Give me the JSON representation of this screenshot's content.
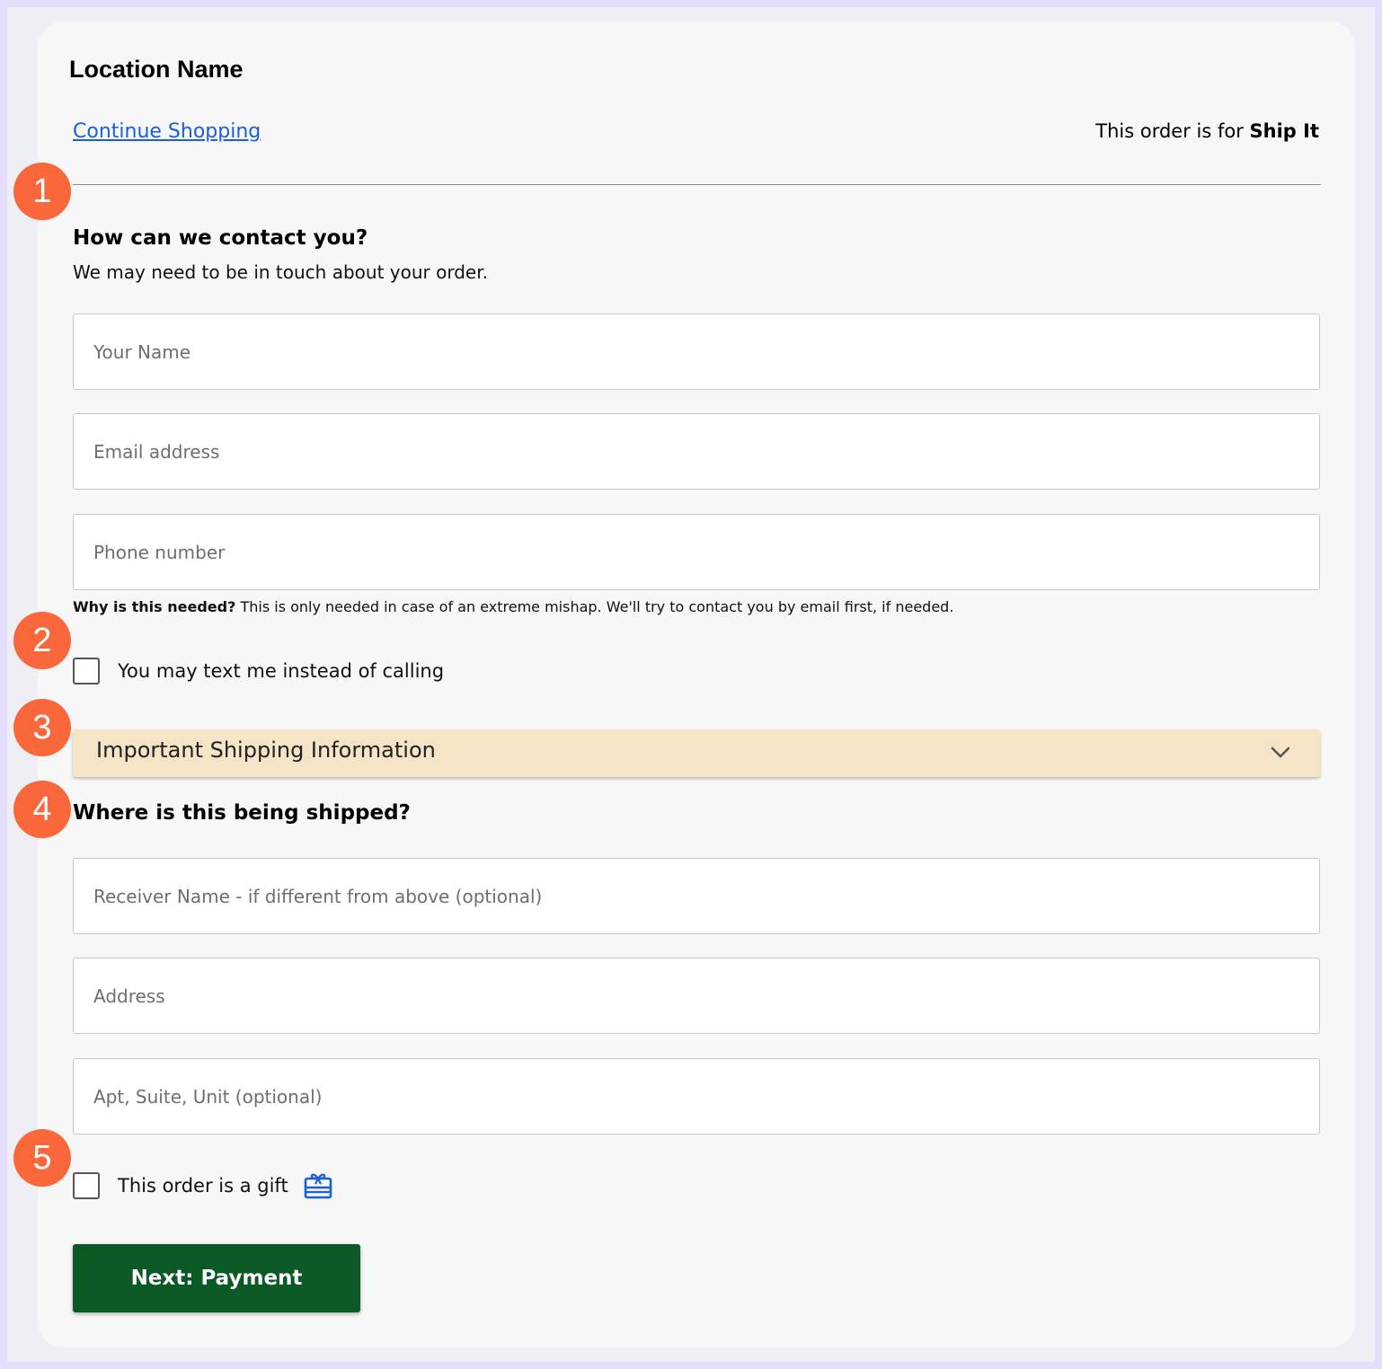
{
  "header": {
    "location_name": "Location Name",
    "continue_shopping": "Continue Shopping",
    "order_for_prefix": "This order is for ",
    "order_for_value": "Ship It"
  },
  "contact": {
    "title": "How can we contact you?",
    "subtitle": "We may need to be in touch about your order.",
    "name_placeholder": "Your Name",
    "email_placeholder": "Email address",
    "phone_placeholder": "Phone number",
    "hint_bold": "Why is this needed?",
    "hint_text": " This is only needed in case of an extreme mishap. We'll try to contact you by email first, if needed.",
    "text_opt_in_label": "You may text me instead of calling"
  },
  "shipping_info": {
    "label": "Important Shipping Information",
    "icon": "chevron-down-icon"
  },
  "shipping": {
    "title": "Where is this being shipped?",
    "receiver_placeholder": "Receiver Name - if different from above (optional)",
    "address_placeholder": "Address",
    "apt_placeholder": "Apt, Suite, Unit (optional)",
    "gift_label": "This order is a gift",
    "gift_icon": "gift-card-icon"
  },
  "actions": {
    "next_label": "Next: Payment"
  },
  "markers": [
    "1",
    "2",
    "3",
    "4",
    "5"
  ],
  "colors": {
    "link": "#1a5ee0",
    "marker": "#f9673a",
    "accordion_bg": "#f6e4c7",
    "primary_button": "#0b5a25",
    "page_border": "#e4ddfb"
  }
}
